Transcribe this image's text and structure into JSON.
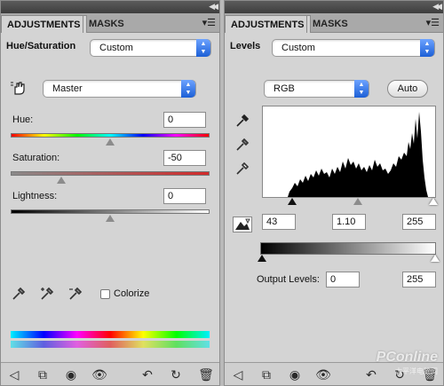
{
  "left_panel": {
    "tabs": [
      "ADJUSTMENTS",
      "MASKS"
    ],
    "panel_menu_icon": "panel-menu-icon",
    "title": "Hue/Saturation",
    "preset": "Custom",
    "channel": "Master",
    "hue": {
      "label": "Hue:",
      "value": "0",
      "level": 0.5
    },
    "saturation": {
      "label": "Saturation:",
      "value": "-50",
      "level": 0.25
    },
    "lightness": {
      "label": "Lightness:",
      "value": "0",
      "level": 0.5
    },
    "colorize_label": "Colorize",
    "colorize_checked": false
  },
  "right_panel": {
    "tabs": [
      "ADJUSTMENTS",
      "MASKS"
    ],
    "title": "Levels",
    "preset": "Custom",
    "channel": "RGB",
    "auto_label": "Auto",
    "input_black": "43",
    "input_gamma": "1.10",
    "input_white": "255",
    "output_label": "Output Levels:",
    "output_black": "0",
    "output_white": "255"
  },
  "bottom_icons": [
    "back-arrow-icon",
    "resize-icon",
    "clip-icon",
    "visibility-eye-icon",
    "previous-state-icon",
    "reset-icon",
    "trash-icon"
  ],
  "watermark": {
    "text": "PConline",
    "sub": "太平洋电脑网"
  },
  "colors": {
    "panel_bg": "#d4d4d4",
    "tab_bar": "#a9a9a9",
    "select_arrow": "#1c5fd6"
  }
}
